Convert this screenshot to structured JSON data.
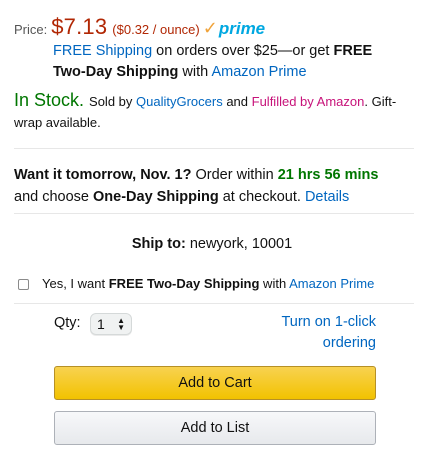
{
  "price": {
    "label": "Price:",
    "value": "$7.13",
    "unit_price": "($0.32 / ounce)",
    "prime_check": "✓",
    "prime_word": "prime"
  },
  "shipping": {
    "free_shipping_link": "FREE Shipping",
    "text1": " on orders over $25—or get ",
    "free_bold": "FREE",
    "two_day_bold": "Two-Day Shipping",
    "with": " with ",
    "amazon_prime_link": "Amazon Prime"
  },
  "stock": {
    "status": "In Stock.",
    "sold_by": "Sold by ",
    "seller": "QualityGrocers",
    "and": " and ",
    "fulfilled": "Fulfilled by Amazon",
    "giftwrap": ". Gift-wrap available."
  },
  "delivery": {
    "want_bold": "Want it tomorrow, Nov. 1?",
    "order_within": " Order within ",
    "countdown": "21 hrs 56 mins",
    "and_choose": "and choose ",
    "one_day_bold": "One-Day Shipping",
    "at_checkout": " at checkout. ",
    "details_link": "Details"
  },
  "ship_to": {
    "label": "Ship to:",
    "location": "newyork, 10001"
  },
  "two_day_option": {
    "checked": false,
    "yes_text": "Yes, I want ",
    "bold": "FREE Two-Day Shipping",
    "with": " with ",
    "link": "Amazon Prime"
  },
  "quantity": {
    "label": "Qty:",
    "value": "1"
  },
  "oneclick": {
    "line1": "Turn on 1-click",
    "line2": "ordering"
  },
  "buttons": {
    "add_to_cart": "Add to Cart",
    "add_to_list": "Add to List"
  },
  "colors": {
    "price_red": "#b12704",
    "link_blue": "#0066c0",
    "stock_green": "#007600",
    "fulfilled_magenta": "#c7137a",
    "prime_blue": "#00a8e1",
    "prime_orange": "#f0a33a",
    "cart_yellow": "#f2c200"
  }
}
